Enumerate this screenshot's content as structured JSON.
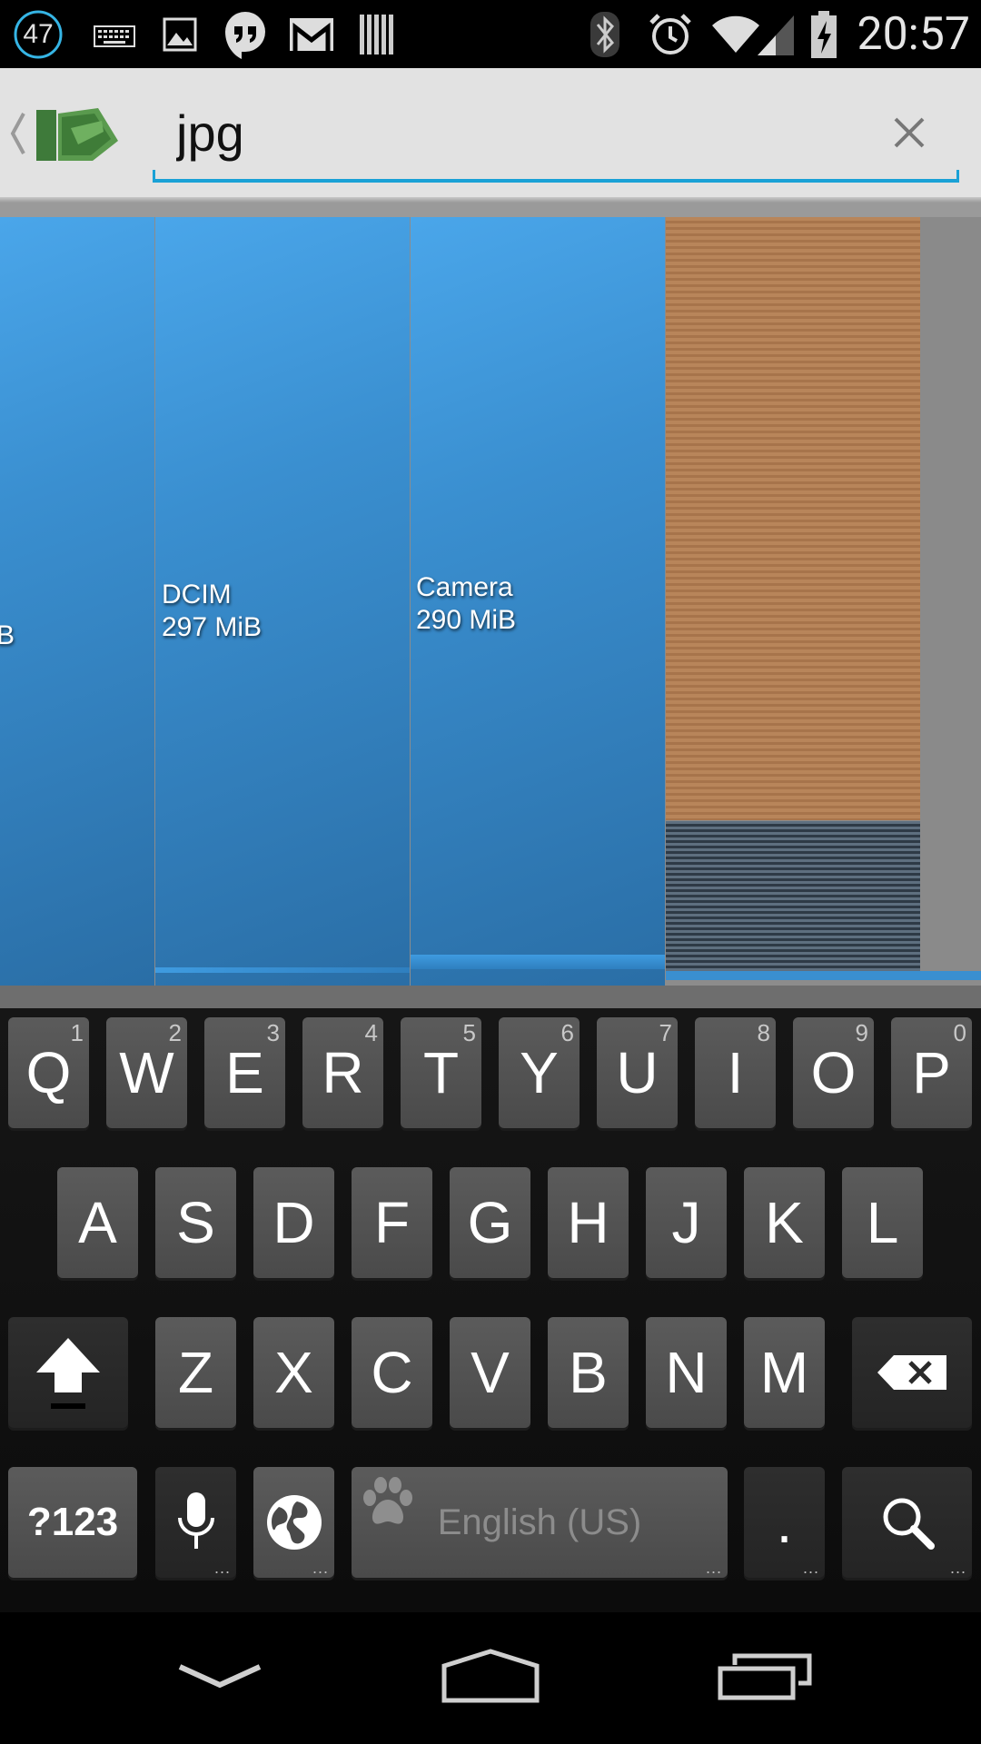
{
  "status_bar": {
    "notification_count": "47",
    "icons": [
      "notification-count-icon",
      "keyboard-icon",
      "image-icon",
      "hangouts-icon",
      "gmail-icon",
      "barcode-icon",
      "bluetooth-icon",
      "alarm-icon",
      "wifi-icon",
      "signal-icon",
      "battery-charging-icon"
    ],
    "time": "20:57"
  },
  "action_bar": {
    "back_icon": "chevron-left-icon",
    "app_icon": "app-logo-icon",
    "search": {
      "value": "jpg",
      "clear_icon": "close-icon"
    },
    "accent_color": "#1aa1d6"
  },
  "treemap": {
    "tiles": [
      {
        "name": "",
        "size": "",
        "partial_label": "B",
        "color": "#3a8fd0"
      },
      {
        "name": "DCIM",
        "size": "297 MiB",
        "color": "#3a8fd0"
      },
      {
        "name": "Camera",
        "size": "290 MiB",
        "color": "#3a8fd0"
      },
      {
        "name": "",
        "size": "",
        "color": "#b8855a"
      },
      {
        "name": "",
        "size": "",
        "color": "#4a5866"
      }
    ]
  },
  "keyboard": {
    "row1": [
      {
        "key": "Q",
        "hint": "1"
      },
      {
        "key": "W",
        "hint": "2"
      },
      {
        "key": "E",
        "hint": "3"
      },
      {
        "key": "R",
        "hint": "4"
      },
      {
        "key": "T",
        "hint": "5"
      },
      {
        "key": "Y",
        "hint": "6"
      },
      {
        "key": "U",
        "hint": "7"
      },
      {
        "key": "I",
        "hint": "8"
      },
      {
        "key": "O",
        "hint": "9"
      },
      {
        "key": "P",
        "hint": "0"
      }
    ],
    "row2": [
      "A",
      "S",
      "D",
      "F",
      "G",
      "H",
      "J",
      "K",
      "L"
    ],
    "row3": [
      "Z",
      "X",
      "C",
      "V",
      "B",
      "N",
      "M"
    ],
    "row4": {
      "symbols": "?123",
      "space": "English (US)",
      "period": ".",
      "more_indicator": "..."
    },
    "icons": [
      "shift-icon",
      "backspace-icon",
      "microphone-icon",
      "globe-icon",
      "paw-icon",
      "search-icon"
    ]
  },
  "nav_bar": {
    "icons": [
      "hide-keyboard-icon",
      "home-icon",
      "recents-icon"
    ]
  }
}
